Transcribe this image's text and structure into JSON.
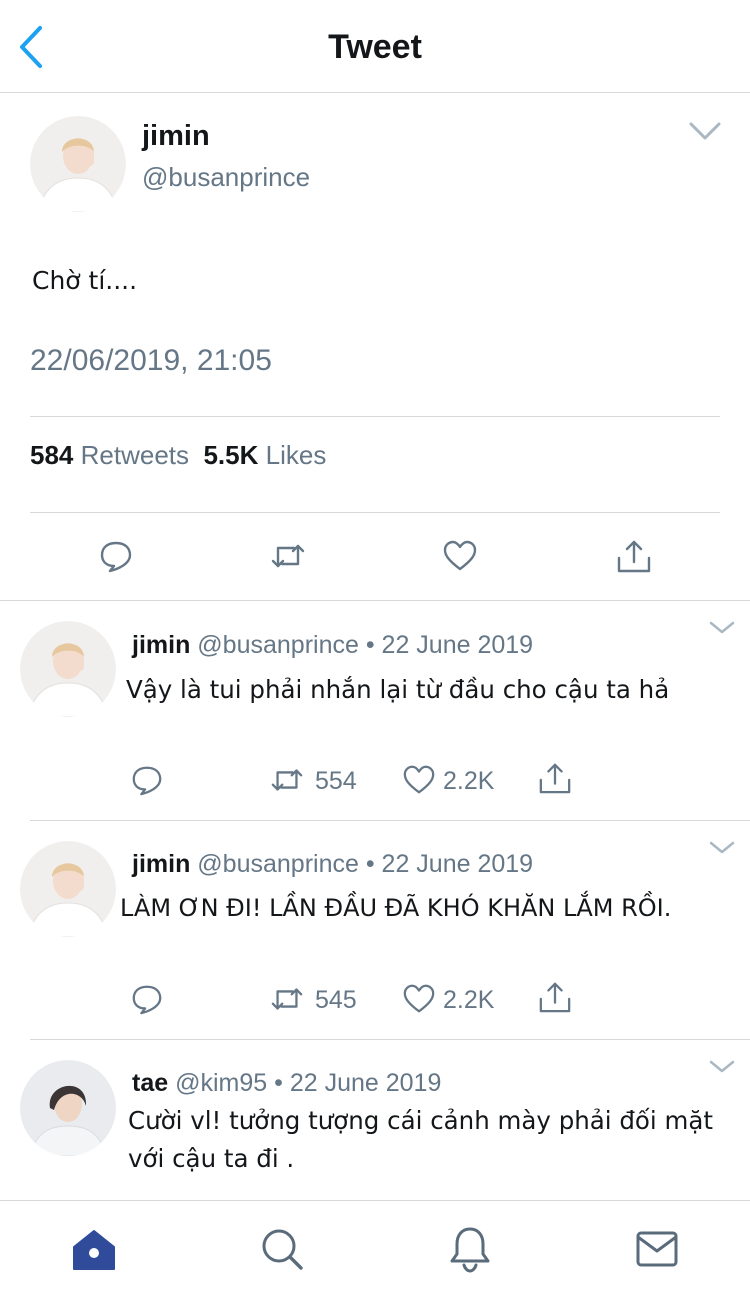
{
  "header": {
    "title": "Tweet"
  },
  "main_tweet": {
    "name": "jimin",
    "handle": "@busanprince",
    "text": "Chờ tí....",
    "datetime": "22/06/2019, 21:05",
    "retweets_count": "584",
    "retweets_label": "Retweets",
    "likes_count": "5.5K",
    "likes_label": "Likes"
  },
  "replies": [
    {
      "name": "jimin",
      "handle": "@busanprince",
      "date": "• 22 June 2019",
      "text": "Vậy là tui phải nhắn lại từ đầu cho cậu ta hả",
      "retweets": "554",
      "likes": "2.2K"
    },
    {
      "name": "jimin",
      "handle": "@busanprince",
      "date": "• 22 June 2019",
      "text": "LÀM ƠN ĐI! LẦN ĐẦU ĐÃ KHÓ KHĂN LẮM RỒI.",
      "retweets": "545",
      "likes": "2.2K"
    },
    {
      "name": "tae",
      "handle": "@kim95",
      "date": "• 22 June 2019",
      "text_line1": "Cười vl! tưởng tượng cái cảnh mày phải đối mặt",
      "text_line2": "với cậu ta đi ."
    }
  ],
  "colors": {
    "accent": "#1da1f2",
    "nav_active": "#2f4b9a",
    "muted": "#657786",
    "divider": "#d5d9dc"
  },
  "tabbar": [
    "home-icon",
    "search-icon",
    "bell-icon",
    "mail-icon"
  ]
}
